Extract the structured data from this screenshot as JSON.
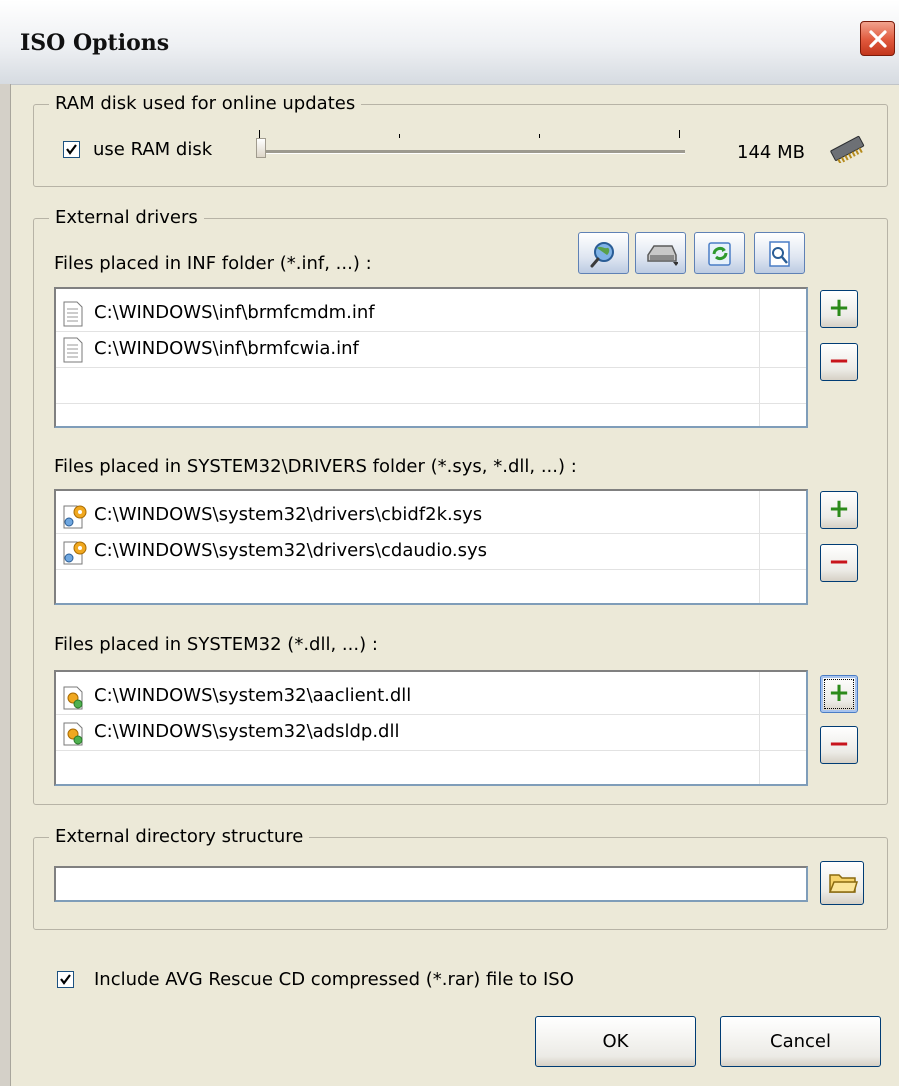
{
  "window": {
    "title": "ISO Options",
    "close_label": "×"
  },
  "ram_group": {
    "legend": "RAM disk used for online updates",
    "checkbox_label": "use RAM disk",
    "checked": true,
    "slider_value_mb": 144,
    "size_label": "144 MB",
    "icon": "ram-chip-icon"
  },
  "drivers_group": {
    "legend": "External drivers",
    "inf": {
      "label": "Files placed in INF folder (*.inf, ...) :",
      "files": [
        "C:\\WINDOWS\\inf\\brmfcmdm.inf",
        "C:\\WINDOWS\\inf\\brmfcwia.inf"
      ],
      "icon": "text-file-icon"
    },
    "drivers": {
      "label": "Files placed in SYSTEM32\\DRIVERS folder (*.sys, *.dll, ...) :",
      "files": [
        "C:\\WINDOWS\\system32\\drivers\\cbidf2k.sys",
        "C:\\WINDOWS\\system32\\drivers\\cdaudio.sys"
      ],
      "icon": "system-file-icon"
    },
    "system32": {
      "label": "Files placed in SYSTEM32 (*.dll, ...) :",
      "files": [
        "C:\\WINDOWS\\system32\\aaclient.dll",
        "C:\\WINDOWS\\system32\\adsldp.dll"
      ],
      "icon": "dll-file-icon"
    },
    "toolbar_icons": [
      "search-icon",
      "drive-icon",
      "refresh-icon",
      "properties-icon"
    ],
    "add_label": "+",
    "remove_label": "−"
  },
  "directory_group": {
    "legend": "External directory structure",
    "path_value": "",
    "browse_icon": "folder-icon"
  },
  "include_rar": {
    "label": "Include AVG Rescue CD compressed (*.rar) file to ISO",
    "checked": true
  },
  "buttons": {
    "ok": "OK",
    "cancel": "Cancel"
  },
  "colors": {
    "plus": "#2b8a1a",
    "minus": "#c8141c",
    "accent": "#003c74",
    "close": "#e0583c"
  }
}
